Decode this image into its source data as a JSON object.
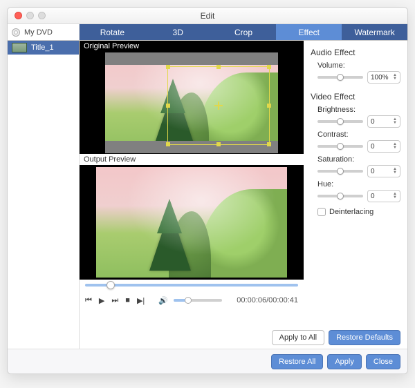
{
  "window": {
    "title": "Edit"
  },
  "sidebar": {
    "root_label": "My DVD",
    "items": [
      {
        "label": "Title_1"
      }
    ]
  },
  "tabs": [
    {
      "id": "rotate",
      "label": "Rotate",
      "active": false
    },
    {
      "id": "3d",
      "label": "3D",
      "active": false
    },
    {
      "id": "crop",
      "label": "Crop",
      "active": false
    },
    {
      "id": "effect",
      "label": "Effect",
      "active": true
    },
    {
      "id": "watermark",
      "label": "Watermark",
      "active": false
    }
  ],
  "previews": {
    "original_label": "Original Preview",
    "output_label": "Output Preview"
  },
  "player": {
    "time_current": "00:00:06",
    "time_total": "00:00:41",
    "time_display": "00:00:06/00:00:41"
  },
  "effects": {
    "audio_section": "Audio Effect",
    "video_section": "Video Effect",
    "volume_label": "Volume:",
    "volume_value": "100%",
    "brightness_label": "Brightness:",
    "brightness_value": "0",
    "contrast_label": "Contrast:",
    "contrast_value": "0",
    "saturation_label": "Saturation:",
    "saturation_value": "0",
    "hue_label": "Hue:",
    "hue_value": "0",
    "deinterlacing_label": "Deinterlacing",
    "deinterlacing_checked": false
  },
  "buttons": {
    "apply_to_all": "Apply to All",
    "restore_defaults": "Restore Defaults",
    "restore_all": "Restore All",
    "apply": "Apply",
    "close": "Close"
  }
}
